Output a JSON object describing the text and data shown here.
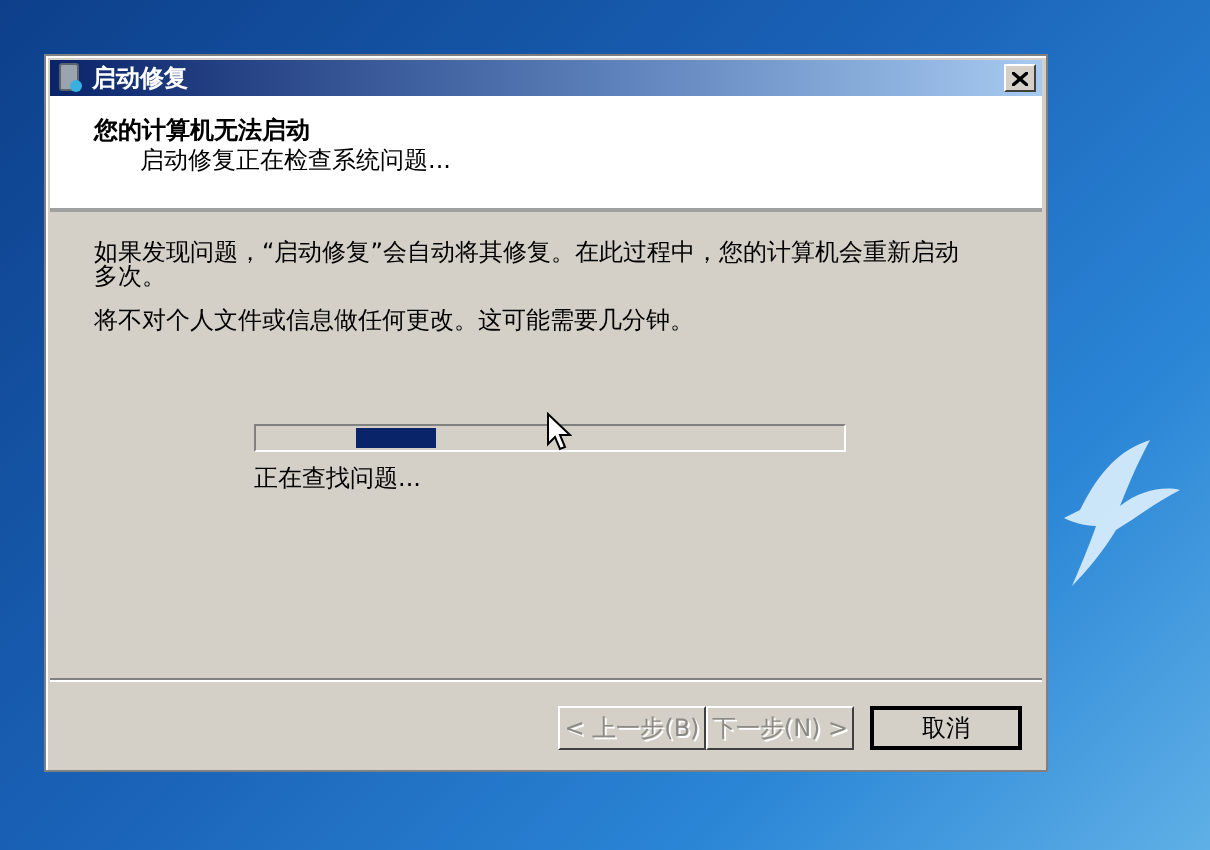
{
  "window": {
    "title": "启动修复"
  },
  "header": {
    "title": "您的计算机无法启动",
    "subtitle": "启动修复正在检查系统问题..."
  },
  "paragraphs": [
    "如果发现问题，“启动修复”会自动将其修复。在此过程中，您的计算机会重新启动多次。",
    "将不对个人文件或信息做任何更改。这可能需要几分钟。"
  ],
  "progress": {
    "status": "正在查找问题..."
  },
  "buttons": [
    {
      "label": "< 上一步(B)",
      "disabled": true,
      "default": false
    },
    {
      "label": "下一步(N) >",
      "disabled": true,
      "default": false
    },
    {
      "label": "取消",
      "disabled": false,
      "default": true
    }
  ]
}
